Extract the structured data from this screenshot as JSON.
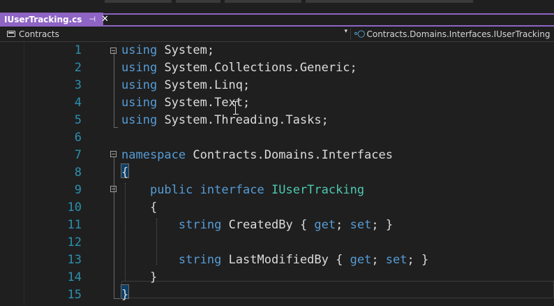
{
  "tab": {
    "title": "IUserTracking.cs",
    "pin_glyph": "⊣",
    "close_glyph": "✕"
  },
  "navbar": {
    "project": "Contracts",
    "dropdown_glyph": "▾",
    "type_path": "Contracts.Domains.Interfaces.IUserTracking",
    "type_icon_glyph": "∘○"
  },
  "editor": {
    "line_numbers": [
      "1",
      "2",
      "3",
      "4",
      "5",
      "6",
      "7",
      "8",
      "9",
      "10",
      "11",
      "12",
      "13",
      "14",
      "15"
    ],
    "using_keyword": "using",
    "usings": [
      "System;",
      "System.Collections.Generic;",
      "System.Linq;",
      "System.Text;",
      "System.Threading.Tasks;"
    ],
    "namespace_keyword": "namespace",
    "namespace_name": "Contracts.Domains.Interfaces",
    "open_brace": "{",
    "close_brace": "}",
    "public_keyword": "public",
    "interface_keyword": "interface",
    "interface_name": "IUserTracking",
    "string_keyword": "string",
    "get_keyword": "get",
    "set_keyword": "set",
    "prop1_name": "CreatedBy",
    "prop2_name": "LastModifiedBy",
    "acc_open": "{ ",
    "semi": "; ",
    "acc_close": "}"
  },
  "colors": {
    "accent": "#8e64c5",
    "keyword": "#569cd6",
    "type": "#4ec9b0",
    "line_number": "#2b91af",
    "text": "#dcdcdc",
    "background": "#1f1f1f"
  }
}
